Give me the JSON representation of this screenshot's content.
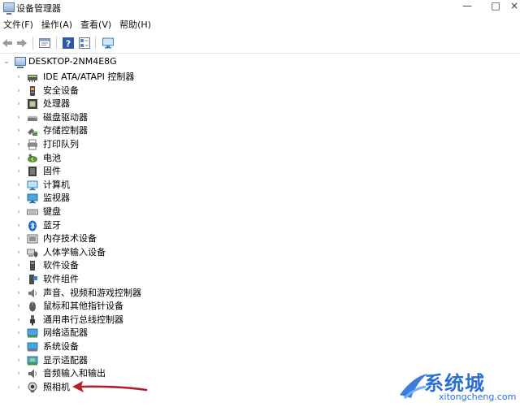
{
  "window": {
    "title": "设备管理器",
    "controls": {
      "minimize": "—",
      "maximize": "□",
      "close": "×"
    }
  },
  "menu": {
    "items": [
      {
        "label": "文件(F)"
      },
      {
        "label": "操作(A)"
      },
      {
        "label": "查看(V)"
      },
      {
        "label": "帮助(H)"
      }
    ]
  },
  "toolbar": {
    "buttons": [
      "back-icon",
      "forward-icon",
      "properties-icon",
      "help-icon",
      "view-icon",
      "monitor-icon"
    ]
  },
  "tree": {
    "root": {
      "label": "DESKTOP-2NM4E8G",
      "expanded": true
    },
    "items": [
      {
        "label": "IDE ATA/ATAPI 控制器",
        "icon": "ide-controller-icon"
      },
      {
        "label": "安全设备",
        "icon": "security-device-icon"
      },
      {
        "label": "处理器",
        "icon": "processor-icon"
      },
      {
        "label": "磁盘驱动器",
        "icon": "disk-drive-icon"
      },
      {
        "label": "存储控制器",
        "icon": "storage-controller-icon"
      },
      {
        "label": "打印队列",
        "icon": "printer-icon"
      },
      {
        "label": "电池",
        "icon": "battery-icon"
      },
      {
        "label": "固件",
        "icon": "firmware-icon"
      },
      {
        "label": "计算机",
        "icon": "computer-icon"
      },
      {
        "label": "监视器",
        "icon": "monitor-icon"
      },
      {
        "label": "键盘",
        "icon": "keyboard-icon"
      },
      {
        "label": "蓝牙",
        "icon": "bluetooth-icon"
      },
      {
        "label": "内存技术设备",
        "icon": "memory-device-icon"
      },
      {
        "label": "人体学输入设备",
        "icon": "hid-icon"
      },
      {
        "label": "软件设备",
        "icon": "software-device-icon"
      },
      {
        "label": "软件组件",
        "icon": "software-component-icon"
      },
      {
        "label": "声音、视频和游戏控制器",
        "icon": "sound-icon"
      },
      {
        "label": "鼠标和其他指针设备",
        "icon": "mouse-icon"
      },
      {
        "label": "通用串行总线控制器",
        "icon": "usb-icon"
      },
      {
        "label": "网络适配器",
        "icon": "network-adapter-icon"
      },
      {
        "label": "系统设备",
        "icon": "system-device-icon"
      },
      {
        "label": "显示适配器",
        "icon": "display-adapter-icon"
      },
      {
        "label": "音频输入和输出",
        "icon": "audio-io-icon"
      },
      {
        "label": "照相机",
        "icon": "camera-icon"
      }
    ]
  },
  "watermark": {
    "title": "系统城",
    "url": "xitongcheng.com"
  },
  "colors": {
    "annotation_arrow": "#b3202a",
    "watermark_blue": "#2a6fd6"
  }
}
